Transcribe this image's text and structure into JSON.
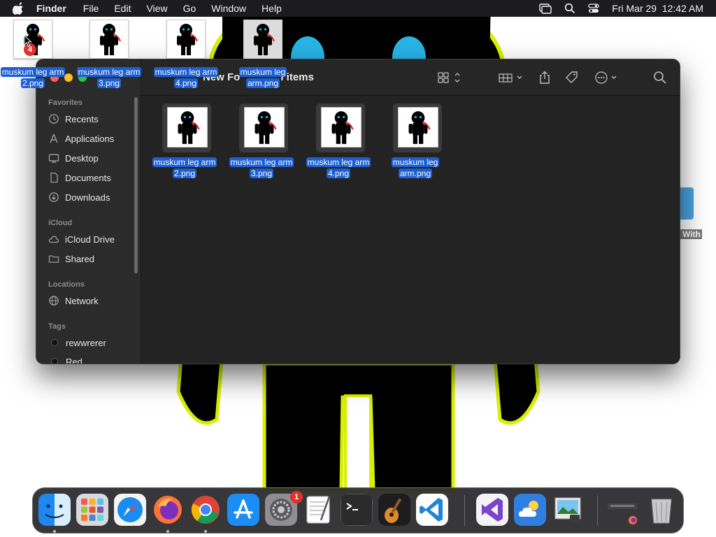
{
  "menubar": {
    "apple_icon": "apple-logo-icon",
    "items": [
      "Finder",
      "File",
      "Edit",
      "View",
      "Go",
      "Window",
      "Help"
    ],
    "status_icons": [
      "screen-mirroring-icon",
      "search-icon",
      "control-center-icon"
    ],
    "datetime": "Fri Mar 29  12:42 AM"
  },
  "desktop": {
    "files": [
      {
        "line1": "muskum leg arm",
        "line2": "2.png",
        "selected": false
      },
      {
        "line1": "muskum leg arm",
        "line2": "3.png",
        "selected": false
      },
      {
        "line1": "muskum leg arm",
        "line2": "4.png",
        "selected": false
      },
      {
        "line1": "muskum leg",
        "line2": "arm.png",
        "selected": true
      }
    ],
    "drag_count_badge": "4",
    "partial_item_label": "r With"
  },
  "finder": {
    "title_start": "New Fo",
    "title_end": "l items",
    "sidebar": {
      "favorites_header": "Favorites",
      "favorites": [
        {
          "label": "Recents",
          "icon": "clock-icon"
        },
        {
          "label": "Applications",
          "icon": "applications-icon"
        },
        {
          "label": "Desktop",
          "icon": "desktop-icon"
        },
        {
          "label": "Documents",
          "icon": "document-icon"
        },
        {
          "label": "Downloads",
          "icon": "download-icon"
        }
      ],
      "icloud_header": "iCloud",
      "icloud": [
        {
          "label": "iCloud Drive",
          "icon": "cloud-icon"
        },
        {
          "label": "Shared",
          "icon": "shared-folder-icon"
        }
      ],
      "locations_header": "Locations",
      "locations": [
        {
          "label": "Network",
          "icon": "network-icon"
        }
      ],
      "tags_header": "Tags",
      "tags": [
        {
          "label": "rewwrerer",
          "color": "#111111"
        },
        {
          "label": "Red",
          "color": "#111111"
        }
      ]
    },
    "toolbar_icons": [
      "icon-view-icon",
      "group-by-icon",
      "share-icon",
      "tag-icon",
      "more-actions-icon",
      "search-icon"
    ],
    "files": [
      {
        "line1": "muskum leg arm",
        "line2": "2.png"
      },
      {
        "line1": "muskum leg arm",
        "line2": "3.png"
      },
      {
        "line1": "muskum leg arm",
        "line2": "4.png"
      },
      {
        "line1": "muskum leg",
        "line2": "arm.png"
      }
    ]
  },
  "dock": {
    "apps": [
      {
        "name": "Finder",
        "icon": "finder-icon",
        "running": true
      },
      {
        "name": "Launchpad",
        "icon": "launchpad-icon",
        "running": false
      },
      {
        "name": "Safari",
        "icon": "safari-icon",
        "running": false
      },
      {
        "name": "Firefox",
        "icon": "firefox-icon",
        "running": true
      },
      {
        "name": "Chrome",
        "icon": "chrome-icon",
        "running": true
      },
      {
        "name": "App Store",
        "icon": "app-store-icon",
        "running": false
      },
      {
        "name": "System Settings",
        "icon": "system-settings-icon",
        "running": false,
        "badge": "1"
      },
      {
        "name": "TextEdit",
        "icon": "textedit-icon",
        "running": false
      },
      {
        "name": "Terminal",
        "icon": "terminal-icon",
        "running": false
      },
      {
        "name": "GarageBand",
        "icon": "garageband-icon",
        "running": false
      },
      {
        "name": "Visual Studio Code",
        "icon": "vscode-icon",
        "running": false
      },
      {
        "name": "Visual Studio",
        "icon": "visual-studio-icon",
        "running": false
      },
      {
        "name": "Weather",
        "icon": "weather-icon",
        "running": false
      },
      {
        "name": "Preview",
        "icon": "preview-icon",
        "running": false
      },
      {
        "name": "Downloads Stack",
        "icon": "downloads-stack-icon",
        "running": false
      },
      {
        "name": "Trash",
        "icon": "trash-icon",
        "running": false
      }
    ]
  },
  "colors": {
    "selection": "#1d5fd1",
    "window_bg": "#232323",
    "sidebar_bg": "#2b2b2b",
    "wallpaper_figure": "#000000",
    "wallpaper_outline": "#d8f000",
    "wallpaper_eyes": "#28b4e6"
  }
}
